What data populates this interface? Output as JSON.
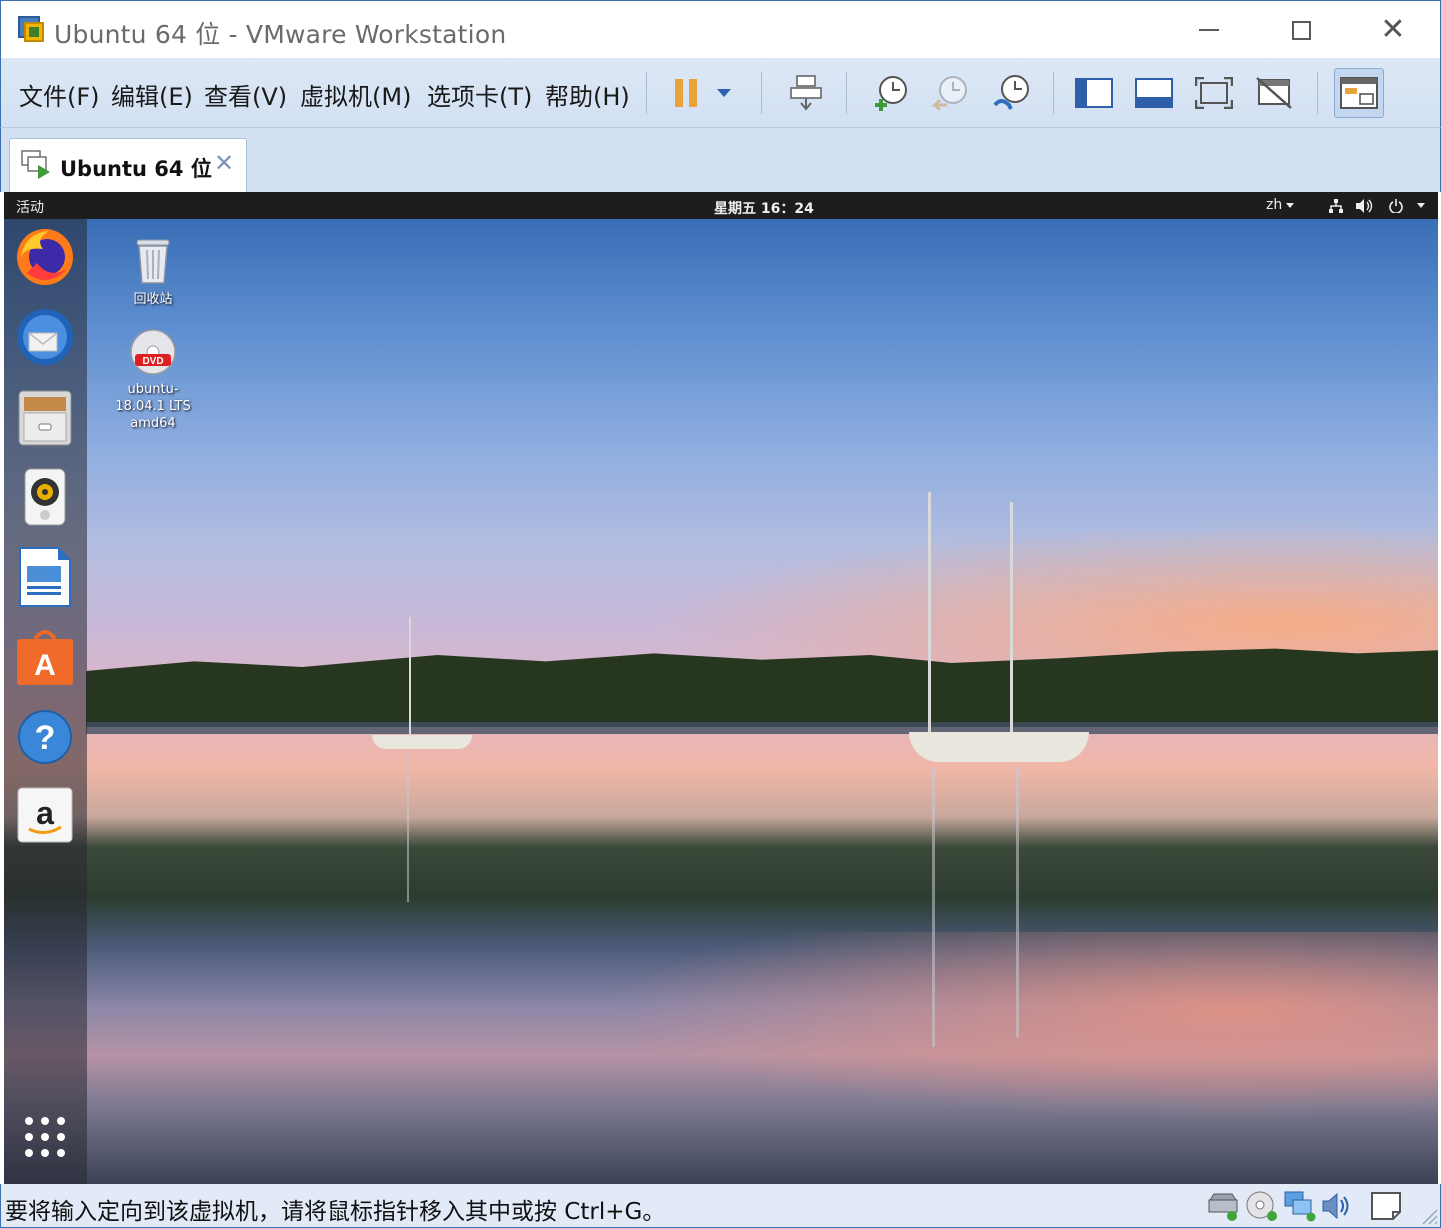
{
  "window": {
    "title": "Ubuntu 64 位 - VMware Workstation",
    "controls": {
      "minimize": "minimize",
      "maximize": "maximize",
      "close": "✕"
    }
  },
  "menu": {
    "items": [
      {
        "label": "文件(F)"
      },
      {
        "label": "编辑(E)"
      },
      {
        "label": "查看(V)"
      },
      {
        "label": "虚拟机(M)"
      },
      {
        "label": "选项卡(T)"
      },
      {
        "label": "帮助(H)"
      }
    ]
  },
  "toolbar": {
    "buttons": [
      {
        "icon": "pause-icon"
      },
      {
        "icon": "dropdown-arrow-icon"
      },
      {
        "icon": "send-ctrl-alt-del-icon"
      },
      {
        "icon": "snapshot-take-icon"
      },
      {
        "icon": "snapshot-revert-icon"
      },
      {
        "icon": "snapshot-manager-icon"
      },
      {
        "icon": "show-library-icon"
      },
      {
        "icon": "thumbnail-bar-icon"
      },
      {
        "icon": "full-screen-icon"
      },
      {
        "icon": "unity-icon"
      },
      {
        "icon": "console-view-icon"
      }
    ],
    "accent": "#e8a33a"
  },
  "tab": {
    "label": "Ubuntu 64 位",
    "close": "✕"
  },
  "vm": {
    "topbar": {
      "activities": "活动",
      "clock": "星期五 16：24",
      "language": "zh",
      "tray_icons": [
        "network-icon",
        "volume-icon",
        "power-icon"
      ]
    },
    "dock": [
      {
        "name": "firefox-icon"
      },
      {
        "name": "thunderbird-icon"
      },
      {
        "name": "files-icon"
      },
      {
        "name": "rhythmbox-icon"
      },
      {
        "name": "libreoffice-writer-icon"
      },
      {
        "name": "ubuntu-software-icon"
      },
      {
        "name": "help-icon"
      },
      {
        "name": "amazon-icon"
      },
      {
        "name": "show-applications-icon"
      }
    ],
    "desktop": {
      "trash_label": "回收站",
      "dvd_label_lines": [
        "ubuntu-",
        "18.04.1 LTS",
        "amd64"
      ]
    }
  },
  "statusbar": {
    "text": "要将输入定向到该虚拟机，请将鼠标指针移入其中或按 Ctrl+G。",
    "icons": [
      "hard-disk-icon",
      "cd-dvd-icon",
      "network-adapter-icon",
      "sound-card-icon",
      "message-log-icon"
    ]
  }
}
